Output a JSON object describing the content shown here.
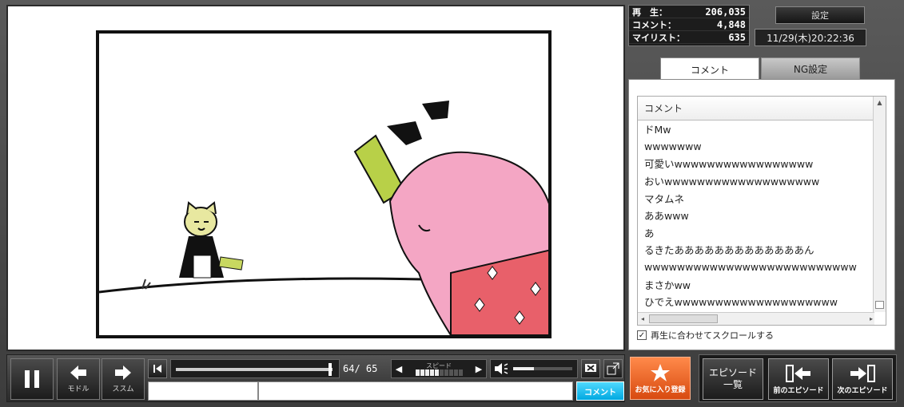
{
  "stats": {
    "views_label": "再　生：",
    "views": "206,035",
    "comments_label": "コメント：",
    "comments": "4,848",
    "mylist_label": "マイリスト：",
    "mylist": "635"
  },
  "header": {
    "settings_label": "設定",
    "datetime": "11/29(木)20:22:36"
  },
  "tabs": [
    {
      "label": "コメント"
    },
    {
      "label": "NG設定"
    }
  ],
  "comment_list": {
    "header": "コメント",
    "items": [
      "ドMw",
      "wwwwwww",
      "可愛いwwwwwwwwwwwwwwwww",
      "おいwwwwwwwwwwwwwwwwwww",
      "マタムネ",
      "ああwww",
      "あ",
      "るきたあああああああああああああん",
      "wwwwwwwwwwwwwwwwwwwwwwwwww",
      "まさかww",
      "ひでえwwwwwwwwwwwwwwwwwwww"
    ]
  },
  "sync_scroll_label": "再生に合わせてスクロールする",
  "controls": {
    "back_label": "モドル",
    "forward_label": "ススム",
    "time": "64/ 65",
    "seek_progress": 0.985,
    "speed_label": "スピード",
    "volume_level": 0.35,
    "comment_submit_label": "コメント"
  },
  "buttons": {
    "favorite_label": "お気に入り登録",
    "episode_list_label": "エピソード\n一覧",
    "prev_episode_label": "前のエピソード",
    "next_episode_label": "次のエピソード"
  },
  "colors": {
    "accent": "#00a8e0",
    "favorite": "#e0561a",
    "character_hair": "#f4a6c4",
    "kimono": "#e8606a",
    "cat": "#e8e8a0",
    "flag": "#b8d048"
  }
}
